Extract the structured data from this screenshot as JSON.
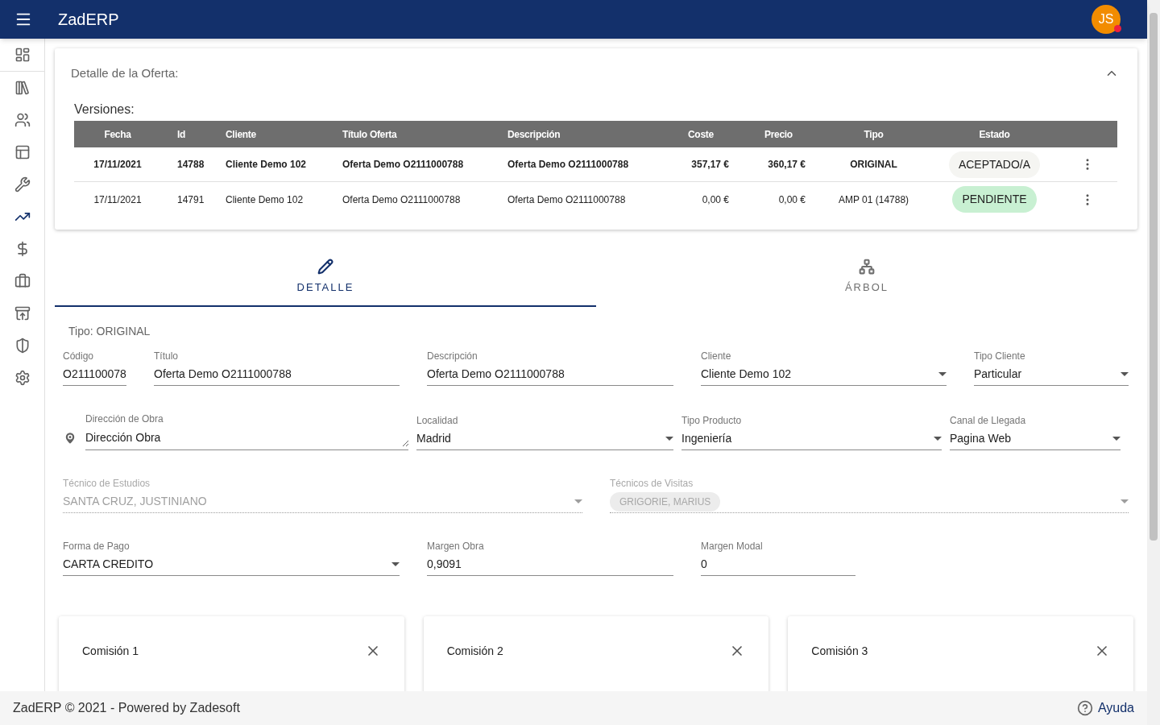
{
  "app_bar": {
    "title": "ZadERP",
    "avatar": {
      "initials": "JS",
      "notification": true
    }
  },
  "panel": {
    "title": "Detalle de la Oferta:",
    "expanded": true,
    "versions_label": "Versiones:",
    "table": {
      "columns": [
        "Fecha",
        "Id",
        "Cliente",
        "Título Oferta",
        "Descripción",
        "Coste",
        "Precio",
        "Tipo",
        "Estado"
      ],
      "rows": [
        {
          "highlighted": true,
          "cells": [
            "17/11/2021",
            "14788",
            "Cliente Demo 102",
            "Oferta Demo O2111000788",
            "Oferta Demo O2111000788",
            "357,17 €",
            "360,17 €",
            "ORIGINAL"
          ],
          "status": {
            "label": "ACEPTADO/A",
            "color": "#f5f5f2"
          }
        },
        {
          "highlighted": false,
          "cells": [
            "17/11/2021",
            "14791",
            "Cliente Demo 102",
            "Oferta Demo O2111000788",
            "Oferta Demo O2111000788",
            "0,00 €",
            "0,00 €",
            "AMP 01 (14788)"
          ],
          "status": {
            "label": "PENDIENTE",
            "color": "#c8f0d2"
          }
        }
      ]
    }
  },
  "tabs": [
    {
      "label": "DETALLE",
      "selected": true
    },
    {
      "label": "ÁRBOL",
      "selected": false
    }
  ],
  "form": {
    "tipo": "Tipo: ORIGINAL",
    "fields": [
      {
        "kind": "text",
        "label": "Código",
        "value": "O211100078",
        "disabled": false
      },
      {
        "kind": "text",
        "label": "Título",
        "value": "Oferta Demo O2111000788",
        "disabled": false
      },
      {
        "kind": "text",
        "label": "Descripción",
        "value": "Oferta Demo O2111000788",
        "disabled": false
      },
      {
        "kind": "select",
        "label": "Cliente",
        "value": "Cliente Demo 102",
        "disabled": false
      },
      {
        "kind": "select",
        "label": "Tipo Cliente",
        "value": "Particular",
        "disabled": false
      },
      {
        "kind": "textarea",
        "label": "Dirección de Obra",
        "value": "Dirección Obra",
        "disabled": false
      },
      {
        "kind": "select",
        "label": "Localidad",
        "value": "Madrid",
        "disabled": false
      },
      {
        "kind": "select",
        "label": "Tipo Producto",
        "value": "Ingeniería",
        "disabled": false
      },
      {
        "kind": "select",
        "label": "Canal de Llegada",
        "value": "Pagina Web",
        "disabled": false
      },
      {
        "kind": "select",
        "label": "Técnico de Estudios",
        "value": "SANTA CRUZ, JUSTINIANO",
        "disabled": true
      },
      {
        "kind": "chips",
        "label": "Técnicos de Visitas",
        "chips": [
          "GRIGORIE, MARIUS"
        ],
        "disabled": true
      },
      {
        "kind": "select",
        "label": "Forma de Pago",
        "value": "CARTA CREDITO",
        "disabled": false
      },
      {
        "kind": "text",
        "label": "Margen Obra",
        "value": "0,9091",
        "disabled": false
      },
      {
        "kind": "text",
        "label": "Margen Modal",
        "value": "0",
        "disabled": false
      }
    ]
  },
  "commissions": [
    {
      "title": "Comisión 1"
    },
    {
      "title": "Comisión 2"
    },
    {
      "title": "Comisión 3"
    }
  ],
  "footer": {
    "text": "ZadERP © 2021 - Powered by Zadesoft",
    "help": "Ayuda"
  }
}
